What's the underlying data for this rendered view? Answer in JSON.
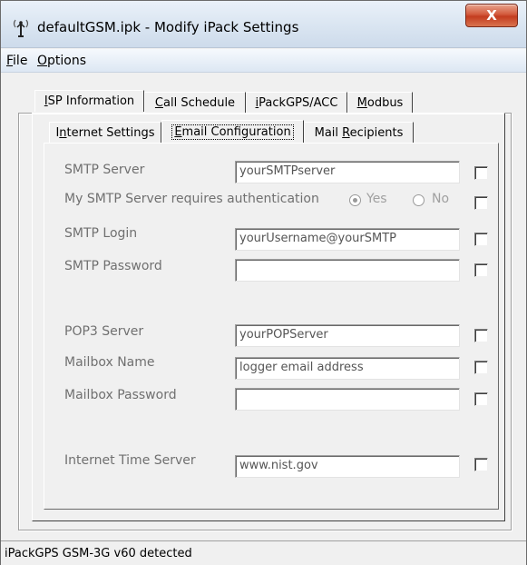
{
  "window": {
    "title": "defaultGSM.ipk - Modify iPack Settings",
    "close_glyph": "X",
    "icon": "antenna-icon"
  },
  "menu": {
    "file": {
      "hot": "F",
      "rest": "ile"
    },
    "options": {
      "hot": "O",
      "rest": "ptions"
    }
  },
  "outer_tabs": [
    {
      "pre": "",
      "hot": "I",
      "rest": "SP Information"
    },
    {
      "pre": "",
      "hot": "C",
      "rest": "all Schedule"
    },
    {
      "pre": "",
      "hot": "i",
      "rest": "PackGPS/ACC"
    },
    {
      "pre": "",
      "hot": "M",
      "rest": "odbus"
    }
  ],
  "inner_tabs": [
    {
      "pre": "I",
      "hot": "n",
      "rest": "ternet Settings"
    },
    {
      "pre": "",
      "hot": "E",
      "rest": "mail Configuration"
    },
    {
      "pre": "Mail ",
      "hot": "R",
      "rest": "ecipients"
    }
  ],
  "form": {
    "smtp_server": {
      "label": "SMTP Server",
      "value": "yourSMTPserver"
    },
    "smtp_auth": {
      "label": "My SMTP Server requires authentication",
      "yes": "Yes",
      "no": "No",
      "selected": "Yes"
    },
    "smtp_login": {
      "label": "SMTP Login",
      "value": "yourUsername@yourSMTP"
    },
    "smtp_password": {
      "label": "SMTP Password",
      "value": ""
    },
    "pop3_server": {
      "label": "POP3 Server",
      "value": "yourPOPServer"
    },
    "mailbox_name": {
      "label": "Mailbox Name",
      "value": "logger email address"
    },
    "mailbox_password": {
      "label": "Mailbox Password",
      "value": ""
    },
    "time_server": {
      "label": "Internet Time Server",
      "value": "www.nist.gov"
    }
  },
  "status": {
    "text": "iPackGPS GSM-3G v60 detected"
  },
  "colors": {
    "close": "#c33c1f",
    "disabled_text": "#707070"
  }
}
